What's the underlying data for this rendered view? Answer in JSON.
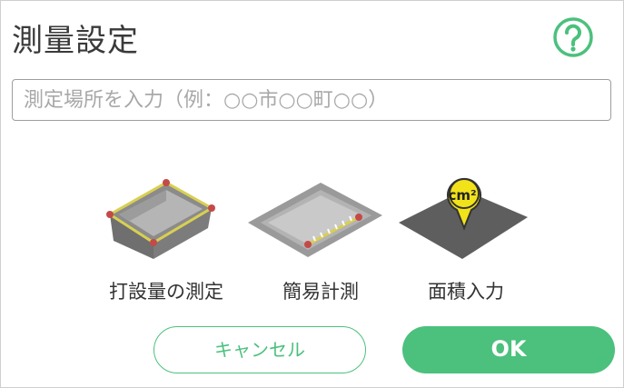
{
  "dialog": {
    "title": "測量設定",
    "help_icon": "question-circle-icon",
    "accent_color": "#4cc07d"
  },
  "search": {
    "placeholder": "測定場所を入力（例：○○市○○町○○）",
    "value": ""
  },
  "options": [
    {
      "label": "打設量の測定",
      "icon": "excavation-box-icon"
    },
    {
      "label": "簡易計測",
      "icon": "flat-area-ruler-icon"
    },
    {
      "label": "面積入力",
      "icon": "area-pin-icon",
      "badge": "cm²"
    }
  ],
  "buttons": {
    "cancel": "キャンセル",
    "ok": "OK"
  }
}
